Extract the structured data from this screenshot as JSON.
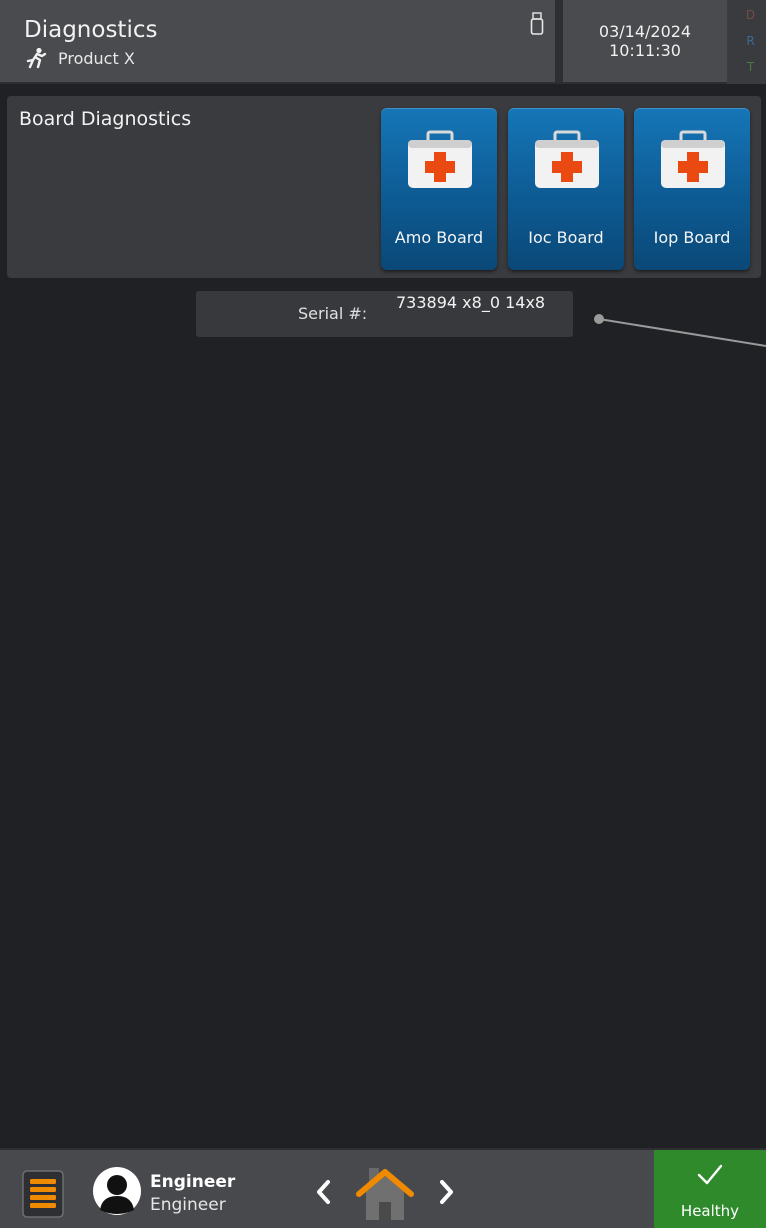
{
  "header": {
    "title": "Diagnostics",
    "product": "Product X",
    "date": "03/14/2024",
    "time": "10:11:30",
    "indicators": [
      "D",
      "R",
      "T"
    ]
  },
  "board_panel": {
    "title": "Board Diagnostics",
    "buttons": [
      {
        "label": "Amo Board",
        "icon": "first-aid-kit-icon"
      },
      {
        "label": "Ioc Board",
        "icon": "first-aid-kit-icon"
      },
      {
        "label": "Iop Board",
        "icon": "first-aid-kit-icon"
      }
    ]
  },
  "serial": {
    "label": "Serial #:",
    "value": "733894 x8_0 14x8"
  },
  "footer": {
    "user_name": "Engineer",
    "user_role": "Engineer",
    "status": "Healthy"
  },
  "colors": {
    "header_bg": "#4a4b4e",
    "page_bg": "#202125",
    "board_button": "#0d5b94",
    "healthy": "#2f8a2c",
    "accent_orange": "#f08a00"
  }
}
